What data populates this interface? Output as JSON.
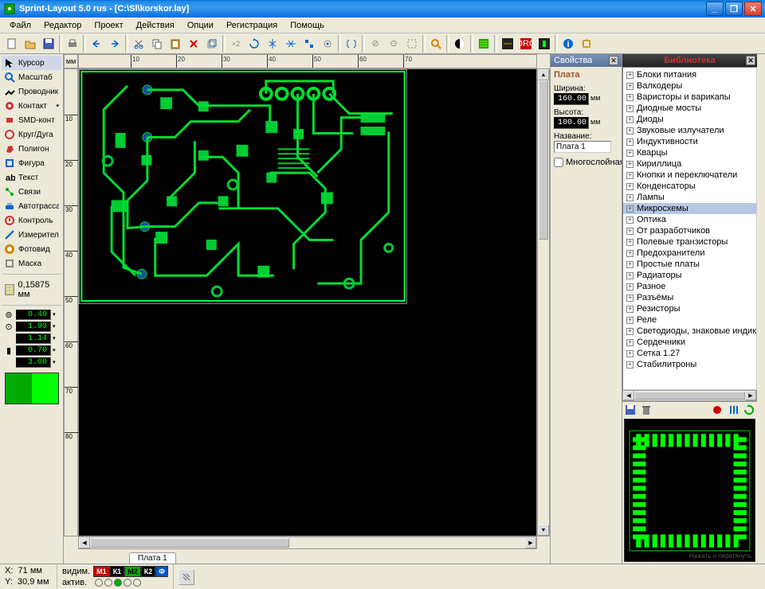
{
  "window": {
    "title": "Sprint-Layout 5.0 rus   - [C:\\Sl\\korskor.lay]"
  },
  "menu": [
    "Файл",
    "Редактор",
    "Проект",
    "Действия",
    "Опции",
    "Регистрация",
    "Помощь"
  ],
  "tools": [
    {
      "icon": "cursor",
      "label": "Курсор",
      "color": "#000"
    },
    {
      "icon": "zoom",
      "label": "Масштаб",
      "color": "#1878c8"
    },
    {
      "icon": "track",
      "label": "Проводник",
      "color": "#000"
    },
    {
      "icon": "pad",
      "label": "Контакт",
      "color": "#d03030",
      "dd": true
    },
    {
      "icon": "smd",
      "label": "SMD-конт",
      "color": "#d03030"
    },
    {
      "icon": "circle",
      "label": "Круг/Дуга",
      "color": "#c83030"
    },
    {
      "icon": "poly",
      "label": "Полигон",
      "color": "#c83030"
    },
    {
      "icon": "shape",
      "label": "Фигура",
      "color": "#1878c8"
    },
    {
      "icon": "text",
      "label": "Текст",
      "color": "#000"
    },
    {
      "icon": "conn",
      "label": "Связи",
      "color": "#18a018"
    },
    {
      "icon": "auto",
      "label": "Автотрасса",
      "color": "#1878c8"
    },
    {
      "icon": "check",
      "label": "Контроль",
      "color": "#c83030"
    },
    {
      "icon": "meas",
      "label": "Измеритель",
      "color": "#1878c8"
    },
    {
      "icon": "photo",
      "label": "Фотовид",
      "color": "#d09018"
    },
    {
      "icon": "mask",
      "label": "Маска",
      "color": "#808080"
    }
  ],
  "grid": {
    "value": "0,15875 мм"
  },
  "params": [
    {
      "sym": "⊚",
      "values": [
        "0.40"
      ]
    },
    {
      "sym": "⊙",
      "values": [
        "1.90",
        "1.14"
      ]
    },
    {
      "sym": "▮",
      "values": [
        "0.70",
        "3.00"
      ]
    }
  ],
  "ruler": {
    "unit": "мм",
    "hticks": [
      10,
      20,
      30,
      40,
      50,
      60,
      70
    ],
    "vticks": [
      10,
      20,
      30,
      40,
      50,
      60,
      70,
      80
    ]
  },
  "tabs": [
    "Плата 1"
  ],
  "props": {
    "panel": "Свойства",
    "section": "Плата",
    "width_lbl": "Ширина:",
    "width_val": "160.00",
    "unit": "мм",
    "height_lbl": "Высота:",
    "height_val": "100.00",
    "name_lbl": "Название:",
    "name_val": "Плата 1",
    "multi": "Многослойная"
  },
  "library": {
    "panel": "Библиотека",
    "items": [
      "Блоки питания",
      "Валкодеры",
      "Варисторы и варикапы",
      "Диодные мосты",
      "Диоды",
      "Звуковые излучатели",
      "Индуктивности",
      "Кварцы",
      "Кириллица",
      "Кнопки и переключатели",
      "Конденсаторы",
      "Лампы",
      "Микросхемы",
      "Оптика",
      "От разработчиков",
      "Полевые транзисторы",
      "Предохранители",
      "Простые платы",
      "Радиаторы",
      "Разное",
      "Разъёмы",
      "Резисторы",
      "Реле",
      "Светодиоды, знаковые индикато",
      "Сердечники",
      "Сетка 1.27",
      "Стабилитроны"
    ],
    "selected": "Микросхемы",
    "hint": "Нажать и перетянуть"
  },
  "status": {
    "x_lbl": "X:",
    "x": "71 мм",
    "y_lbl": "Y:",
    "y": "30,9 мм",
    "vidim": "видим.",
    "aktiv": "актив.",
    "layers": [
      {
        "t": "М1",
        "bg": "#c00",
        "fg": "#fff"
      },
      {
        "t": "К1",
        "bg": "#000",
        "fg": "#fff"
      },
      {
        "t": "М2",
        "bg": "#0a0",
        "fg": "#000"
      },
      {
        "t": "К2",
        "bg": "#000",
        "fg": "#fff"
      },
      {
        "t": "Ф",
        "bg": "#05c",
        "fg": "#fff"
      }
    ]
  }
}
